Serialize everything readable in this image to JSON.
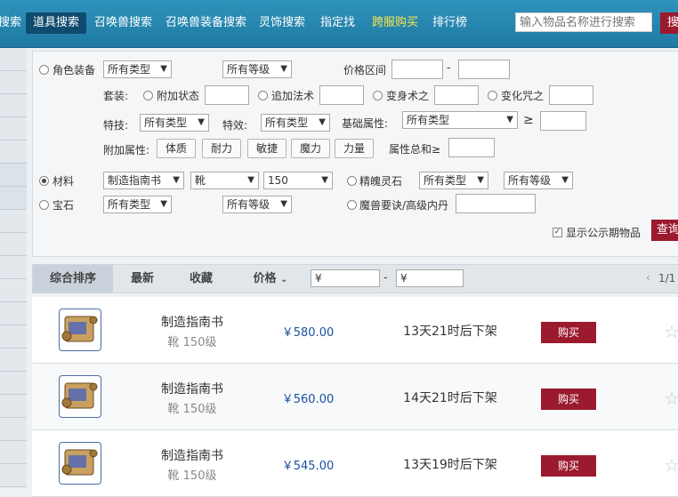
{
  "nav": {
    "tabs": [
      "搜索",
      "道具搜索",
      "召唤兽搜索",
      "召唤兽装备搜索",
      "灵饰搜索",
      "指定找",
      "跨服购买",
      "排行榜"
    ],
    "search_placeholder": "输入物品名称进行搜索",
    "search_button": "搜"
  },
  "filters": {
    "role_equip": {
      "label": "角色装备",
      "type_select": "所有类型",
      "level_select": "所有等级",
      "price_range_label": "价格区间",
      "dash": "-"
    },
    "suit": {
      "label": "套装:",
      "options": [
        "附加状态",
        "追加法术",
        "变身术之",
        "变化咒之"
      ]
    },
    "special": {
      "skill_label": "特技:",
      "skill_select": "所有类型",
      "effect_label": "特效:",
      "effect_select": "所有类型",
      "base_attr_label": "基础属性:",
      "base_attr_select": "所有类型",
      "gte": "≥"
    },
    "extra_attr": {
      "label": "附加属性:",
      "buttons": [
        "体质",
        "耐力",
        "敏捷",
        "魔力",
        "力量"
      ],
      "sum_label": "属性总和≥"
    },
    "material": {
      "label": "材料",
      "select1": "制造指南书",
      "select2": "靴",
      "select3": "150",
      "spirit_label": "精魄灵石",
      "spirit_type": "所有类型",
      "spirit_level": "所有等级"
    },
    "gem": {
      "label": "宝石",
      "type_select": "所有类型",
      "level_select": "所有等级",
      "beast_label": "魔兽要诀/高级内丹"
    },
    "show_public": "显示公示期物品",
    "query_button": "查询"
  },
  "sort": {
    "tabs": [
      "综合排序",
      "最新",
      "收藏",
      "价格"
    ],
    "yen1": "¥",
    "dash": "-",
    "yen2": "¥",
    "page": "1/1",
    "prev": "‹"
  },
  "items": [
    {
      "name": "制造指南书",
      "sub": "靴  150级",
      "price": "￥580.00",
      "time": "13天21时后下架",
      "buy": "购买"
    },
    {
      "name": "制造指南书",
      "sub": "靴  150级",
      "price": "￥560.00",
      "time": "14天21时后下架",
      "buy": "购买"
    },
    {
      "name": "制造指南书",
      "sub": "靴  150级",
      "price": "￥545.00",
      "time": "13天19时后下架",
      "buy": "购买"
    }
  ],
  "colors": {
    "nav": "#1f7aa2",
    "accent": "#9b1a2e",
    "price": "#1c4fa0",
    "cross_server": "#ffe84a"
  }
}
